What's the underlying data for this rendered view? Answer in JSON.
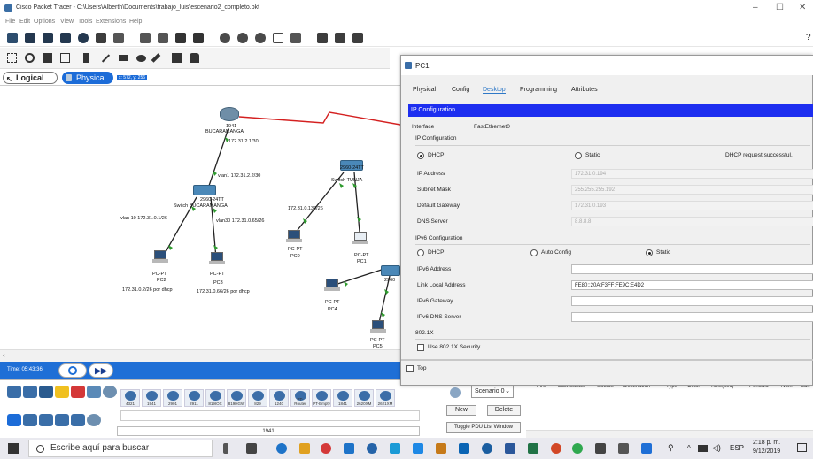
{
  "app": {
    "title": "Cisco Packet Tracer - C:\\Users\\Alberth\\Documents\\trabajo_luis\\escenario2_completo.pkt",
    "menu": [
      "File",
      "Edit",
      "Options",
      "View",
      "Tools",
      "Extensions",
      "Help"
    ],
    "help_mark": "?"
  },
  "workspace": {
    "logical_tab": "Logical",
    "physical_tab": "Physical",
    "coords": "x: 572, y: 256"
  },
  "topology": {
    "labels": [
      "1941",
      "BUCARAMANGA",
      "172.31.2.1/30",
      "vlan1 172.31.2.2/30",
      "2960-24TT",
      "Switch BUCARAMANGA",
      "vlan 10 172.31.0.1/26",
      "vlan30 172.31.0.65/26",
      "PC-PT",
      "PC2",
      "172.31.0.2/26 por dhcp",
      "PC3",
      "172.31.0.66/26 por dhcp",
      "2960-24TT",
      "Switch TUNJA",
      "172.31.0.130/26",
      "PC0",
      "PC1",
      "PC4",
      "PC5",
      "2960"
    ]
  },
  "timebar": {
    "time": "Time: 05:43:36"
  },
  "palette": {
    "models": [
      "4321",
      "1941",
      "2901",
      "2911",
      "819IOX",
      "819HGW",
      "829",
      "1240",
      "PT-Router",
      "PT-Empty",
      "1841",
      "2620XM",
      "2621XM"
    ],
    "selected_model": "1941"
  },
  "pdu": {
    "scenario": "Scenario 0",
    "new_label": "New",
    "delete_label": "Delete",
    "toggle_label": "Toggle PDU List Window",
    "columns": [
      "Fire",
      "Last Status",
      "Source",
      "Destination",
      "Type",
      "Color",
      "Time(sec)",
      "Periodic",
      "Num",
      "Edit"
    ]
  },
  "dialog": {
    "title": "PC1",
    "tabs": [
      "Physical",
      "Config",
      "Desktop",
      "Programming",
      "Attributes"
    ],
    "active_tab": "Desktop",
    "section_title": "IP Configuration",
    "interface_label": "Interface",
    "interface_value": "FastEthernet0",
    "ipconf_label": "IP Configuration",
    "dhcp_label": "DHCP",
    "static_label": "Static",
    "dhcp_status": "DHCP request successful.",
    "fields": {
      "ip_label": "IP Address",
      "ip_value": "172.31.0.194",
      "mask_label": "Subnet Mask",
      "mask_value": "255.255.255.192",
      "gw_label": "Default Gateway",
      "gw_value": "172.31.0.193",
      "dns_label": "DNS Server",
      "dns_value": "8.8.8.8"
    },
    "ipv6": {
      "title": "IPv6 Configuration",
      "dhcp_label": "DHCP",
      "auto_label": "Auto Config",
      "static_label": "Static",
      "addr_label": "IPv6 Address",
      "addr_value": "",
      "link_label": "Link Local Address",
      "link_value": "FE80::20A:F3FF:FE9C:E4D2",
      "gw_label": "IPv6 Gateway",
      "gw_value": "",
      "dns_label": "IPv6 DNS Server",
      "dns_value": ""
    },
    "dot1x": {
      "title": "802.1X",
      "use_label": "Use 802.1X Security"
    },
    "top_label": "Top"
  },
  "taskbar": {
    "search_placeholder": "Escribe aquí para buscar",
    "lang": "ESP",
    "time": "2:18 p. m.",
    "date": "9/12/2019"
  },
  "colors": {
    "accent": "#1f6fd6",
    "ip_bar": "#1d2ef0",
    "serial_link": "#d42020",
    "link_green": "#2f9b2f"
  }
}
